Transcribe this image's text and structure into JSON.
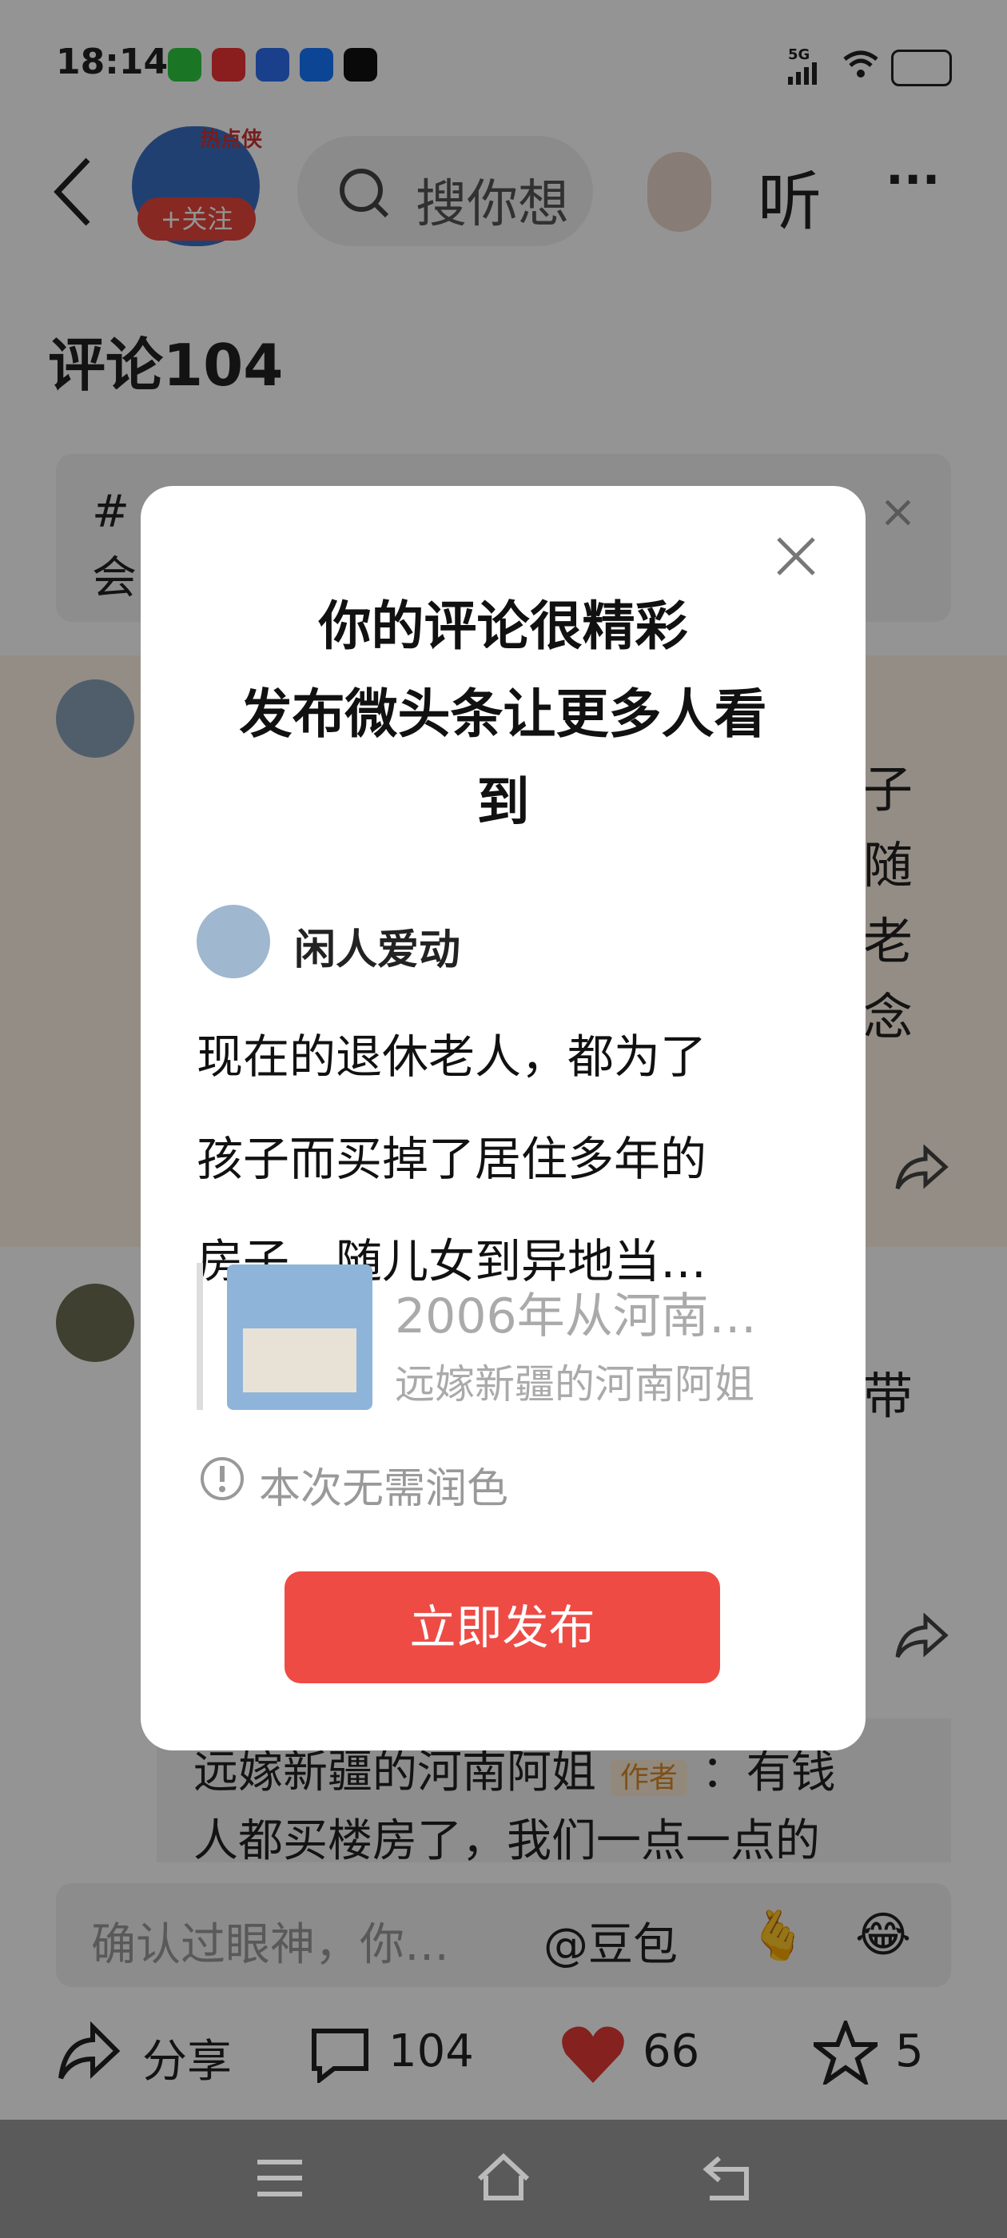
{
  "status_bar": {
    "time": "18:14",
    "network": "5G",
    "app_icons": [
      "wechat-icon",
      "toutiao-icon",
      "baidu-icon",
      "alipay-icon",
      "tiktok-icon"
    ]
  },
  "header": {
    "follow_label": "+关注",
    "badge_text": "热点侠",
    "search_placeholder": "搜你想",
    "listen_label": "听",
    "more_label": "···"
  },
  "comments": {
    "title": "评论104",
    "topic_line1": "#",
    "topic_line2": "会",
    "right_chars_1": [
      "子",
      "随",
      "老",
      "念"
    ],
    "right_char_2": "带",
    "reply": {
      "author": "远嫁新疆的河南阿姐",
      "tag": "作者",
      "text_line1": "：有钱",
      "text_line2": "人都买楼房了，我们一点一点的"
    }
  },
  "modal": {
    "title_lines": [
      "你的评论很精彩",
      "发布微头条让更多人看",
      "到"
    ],
    "user_name": "闲人爱动",
    "comment_lines": [
      "现在的退休老人，都为了",
      "孩子而买掉了居住多年的",
      "房子，随儿女到异地当…"
    ],
    "quote_title": "2006年从河南…",
    "quote_author": "远嫁新疆的河南阿姐",
    "notice": "本次无需润色",
    "publish_label": "立即发布",
    "close_label": "×"
  },
  "input_bar": {
    "placeholder": "确认过眼神，你…",
    "mention": "@豆包",
    "emoji1": "🫰",
    "emoji2": "😂"
  },
  "action_bar": {
    "share_label": "分享",
    "comment_count": "104",
    "like_count": "66",
    "favorite_count": "5"
  },
  "colors": {
    "accent": "#ee4b45",
    "overlay": "rgba(0,0,0,0.42)",
    "nav_bar": "#5a5a5a"
  }
}
